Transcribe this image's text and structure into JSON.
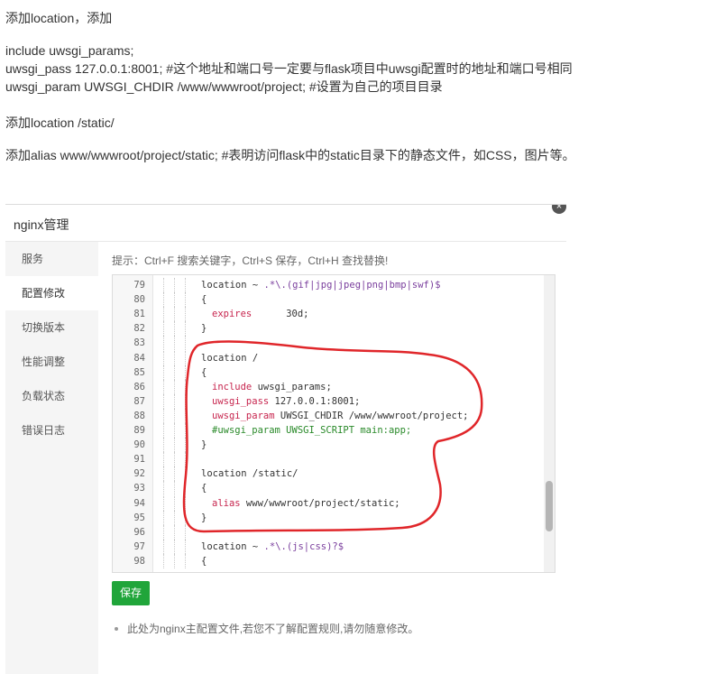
{
  "article": {
    "para1": "添加location，添加",
    "para2": [
      "include uwsgi_params;",
      "uwsgi_pass 127.0.0.1:8001;  #这个地址和端口号一定要与flask项目中uwsgi配置时的地址和端口号相同",
      "uwsgi_param UWSGI_CHDIR /www/wwwroot/project;  #设置为自己的项目目录"
    ],
    "para3": "添加location /static/",
    "para4": "添加alias www/wwwroot/project/static;  #表明访问flask中的static目录下的静态文件，如CSS，图片等。"
  },
  "panel": {
    "title": "nginx管理",
    "close_icon": "×",
    "sidebar": [
      {
        "label": "服务",
        "active": false
      },
      {
        "label": "配置修改",
        "active": true
      },
      {
        "label": "切换版本",
        "active": false
      },
      {
        "label": "性能调整",
        "active": false
      },
      {
        "label": "负载状态",
        "active": false
      },
      {
        "label": "错误日志",
        "active": false
      }
    ],
    "hint": "提示：Ctrl+F 搜索关键字，Ctrl+S 保存，Ctrl+H 查找替换!",
    "save_label": "保存",
    "note": "此处为nginx主配置文件,若您不了解配置规则,请勿随意修改。"
  },
  "editor": {
    "lines": [
      {
        "n": "79",
        "indent": 1,
        "parts": [
          [
            "t",
            "location ~ "
          ],
          [
            "re",
            ".*\\.(gif|jpg|jpeg|png|bmp|swf)$"
          ]
        ]
      },
      {
        "n": "80",
        "indent": 1,
        "parts": [
          [
            "t",
            "{"
          ]
        ]
      },
      {
        "n": "81",
        "indent": 2,
        "parts": [
          [
            "kw",
            "expires"
          ],
          [
            "t",
            "      30d;"
          ]
        ]
      },
      {
        "n": "82",
        "indent": 1,
        "parts": [
          [
            "t",
            "}"
          ]
        ]
      },
      {
        "n": "83",
        "indent": 1,
        "parts": []
      },
      {
        "n": "84",
        "indent": 1,
        "parts": [
          [
            "t",
            "location /"
          ]
        ]
      },
      {
        "n": "85",
        "indent": 1,
        "parts": [
          [
            "t",
            "{"
          ]
        ]
      },
      {
        "n": "86",
        "indent": 2,
        "parts": [
          [
            "kw",
            "include"
          ],
          [
            "t",
            " uwsgi_params;"
          ]
        ]
      },
      {
        "n": "87",
        "indent": 2,
        "parts": [
          [
            "kw",
            "uwsgi_pass"
          ],
          [
            "t",
            " 127.0.0.1:8001;"
          ]
        ]
      },
      {
        "n": "88",
        "indent": 2,
        "parts": [
          [
            "kw",
            "uwsgi_param"
          ],
          [
            "t",
            " UWSGI_CHDIR /www/wwwroot/project;"
          ]
        ]
      },
      {
        "n": "89",
        "indent": 2,
        "parts": [
          [
            "cm",
            "#uwsgi_param UWSGI_SCRIPT main:app;"
          ]
        ]
      },
      {
        "n": "90",
        "indent": 1,
        "parts": [
          [
            "t",
            "}"
          ]
        ]
      },
      {
        "n": "91",
        "indent": 1,
        "parts": []
      },
      {
        "n": "92",
        "indent": 1,
        "parts": [
          [
            "t",
            "location /static/"
          ]
        ]
      },
      {
        "n": "93",
        "indent": 1,
        "parts": [
          [
            "t",
            "{"
          ]
        ]
      },
      {
        "n": "94",
        "indent": 2,
        "parts": [
          [
            "kw",
            "alias"
          ],
          [
            "t",
            " www/wwwroot/project/static;"
          ]
        ]
      },
      {
        "n": "95",
        "indent": 1,
        "parts": [
          [
            "t",
            "}"
          ]
        ]
      },
      {
        "n": "96",
        "indent": 1,
        "parts": []
      },
      {
        "n": "97",
        "indent": 1,
        "parts": [
          [
            "t",
            "location ~ "
          ],
          [
            "re",
            ".*\\.(js|css)?$"
          ]
        ]
      },
      {
        "n": "98",
        "indent": 1,
        "parts": [
          [
            "t",
            "{"
          ]
        ]
      }
    ]
  },
  "colors": {
    "accent": "#20a53a",
    "annotation": "#e0262a",
    "keyword": "#c7254e",
    "comment": "#2a8a2a"
  }
}
